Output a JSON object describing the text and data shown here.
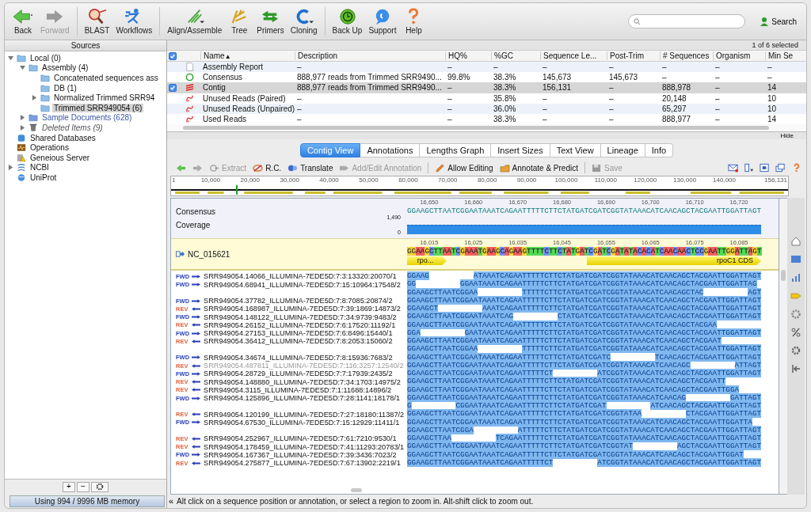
{
  "toolbar": [
    [
      {
        "label": "Back",
        "kind": "back",
        "disabled": false
      },
      {
        "label": "Forward",
        "kind": "forward",
        "disabled": true
      }
    ],
    [
      {
        "label": "BLAST",
        "kind": "blast",
        "disabled": false
      },
      {
        "label": "Workflows",
        "kind": "workflows",
        "disabled": false
      }
    ],
    [
      {
        "label": "Align/Assemble",
        "kind": "align",
        "disabled": false
      },
      {
        "label": "Tree",
        "kind": "tree",
        "disabled": false
      },
      {
        "label": "Primers",
        "kind": "primers",
        "disabled": false
      },
      {
        "label": "Cloning",
        "kind": "cloning",
        "disabled": false
      }
    ],
    [
      {
        "label": "Back Up",
        "kind": "backup",
        "disabled": false
      },
      {
        "label": "Support",
        "kind": "support",
        "disabled": false
      },
      {
        "label": "Help",
        "kind": "help",
        "disabled": false
      }
    ]
  ],
  "search_button": "Search",
  "sidebar": {
    "title": "Sources",
    "tree": [
      {
        "label": "Local (0)",
        "kind": "folder",
        "expandable": true,
        "expanded": true,
        "selected": false,
        "children": [
          {
            "label": "Assembly (4)",
            "kind": "folder",
            "expandable": true,
            "expanded": true,
            "selected": false,
            "children": [
              {
                "label": "Concatenated sequences ass",
                "kind": "folder",
                "expandable": false,
                "selected": false
              },
              {
                "label": "DB (1)",
                "kind": "folder",
                "expandable": false,
                "selected": false
              },
              {
                "label": "Normalized Trimmed SRR94",
                "kind": "folder",
                "expandable": true,
                "expanded": false,
                "selected": false
              },
              {
                "label": "Trimmed SRR949054 (6)",
                "kind": "folder",
                "expandable": false,
                "selected": true
              }
            ]
          },
          {
            "label": "Sample Documents (628)",
            "kind": "sample",
            "expandable": true,
            "expanded": false,
            "selected": false
          },
          {
            "label": "Deleted Items (9)",
            "kind": "trash",
            "expandable": true,
            "expanded": false,
            "selected": false
          }
        ]
      },
      {
        "label": "Shared Databases",
        "kind": "database",
        "expandable": false,
        "selected": false
      },
      {
        "label": "Operations",
        "kind": "operations",
        "expandable": false,
        "selected": false
      },
      {
        "label": "Geneious Server",
        "kind": "server",
        "expandable": false,
        "selected": false
      },
      {
        "label": "NCBI",
        "kind": "ncbi",
        "expandable": true,
        "expanded": false,
        "selected": false
      },
      {
        "label": "UniProt",
        "kind": "uniprot",
        "expandable": false,
        "selected": false
      }
    ],
    "buttons": [
      "+",
      "−"
    ],
    "memory": "Using 994 / 9996 MB memory",
    "collapse": "«"
  },
  "selection_count": "1 of 6 selected",
  "table": {
    "all_checked": true,
    "columns": [
      {
        "label": "Name",
        "sort_mark": "▲"
      },
      {
        "label": "Description"
      },
      {
        "label": "HQ%"
      },
      {
        "label": "%GC"
      },
      {
        "label": "Sequence Le..."
      },
      {
        "label": "Post-Trim"
      },
      {
        "label": "# Sequences"
      },
      {
        "label": "Organism"
      },
      {
        "label": "Min Se"
      }
    ],
    "rows": [
      {
        "kind": "report",
        "checked": false,
        "selected": false,
        "cells": [
          "Assembly Report",
          "–",
          "–",
          "–",
          "–",
          "–",
          "–",
          "–",
          "–"
        ]
      },
      {
        "kind": "consensus",
        "checked": false,
        "selected": false,
        "cells": [
          "Consensus",
          "888,977 reads from Trimmed SRR9490...",
          "99.8%",
          "38.3%",
          "145,673",
          "145,673",
          "–",
          "–",
          "–"
        ]
      },
      {
        "kind": "contig",
        "checked": true,
        "selected": true,
        "cells": [
          "Contig",
          "888,977 reads from Trimmed SRR9490...",
          "–",
          "38.3%",
          "156,131",
          "–",
          "888,978",
          "–",
          "14"
        ]
      },
      {
        "kind": "reads",
        "checked": false,
        "selected": false,
        "cells": [
          "Unused Reads (Paired)",
          "–",
          "–",
          "35.8%",
          "–",
          "–",
          "20,148",
          "–",
          "10"
        ]
      },
      {
        "kind": "reads",
        "checked": false,
        "selected": false,
        "cells": [
          "Unused Reads (Unpaired)",
          "–",
          "–",
          "36.0%",
          "–",
          "–",
          "65,297",
          "–",
          "10"
        ]
      },
      {
        "kind": "reads",
        "checked": false,
        "selected": false,
        "cells": [
          "Used Reads",
          "–",
          "–",
          "38.3%",
          "–",
          "–",
          "888,977",
          "–",
          "14"
        ]
      }
    ]
  },
  "hide": "Hide",
  "tabs": [
    {
      "label": "Contig View",
      "selected": true
    },
    {
      "label": "Annotations",
      "selected": false
    },
    {
      "label": "Lengths Graph",
      "selected": false
    },
    {
      "label": "Insert Sizes",
      "selected": false
    },
    {
      "label": "Text View",
      "selected": false
    },
    {
      "label": "Lineage",
      "selected": false
    },
    {
      "label": "Info",
      "selected": false
    }
  ],
  "viewer_tools": [
    {
      "kind": "back",
      "disabled": false
    },
    {
      "kind": "forward",
      "disabled": true
    },
    {
      "kind": "extract",
      "label": "Extract",
      "disabled": true
    },
    {
      "kind": "rc",
      "label": "R.C.",
      "disabled": false
    },
    {
      "kind": "translate",
      "label": "Translate",
      "disabled": false
    },
    {
      "kind": "annotation",
      "label": "Add/Edit Annotation",
      "disabled": true
    },
    {
      "kind": "edit",
      "label": "Allow Editing",
      "disabled": false
    },
    {
      "kind": "predict",
      "label": "Annotate & Predict",
      "disabled": false
    },
    {
      "kind": "save",
      "label": "Save",
      "disabled": true
    }
  ],
  "overview_ticks": [
    "1",
    "10,000",
    "20,000",
    "30,000",
    "40,000",
    "50,000",
    "60,000",
    "70,000",
    "80,000",
    "90,000",
    "100,000",
    "110,000",
    "120,000",
    "130,000",
    "140,000",
    "156,131"
  ],
  "consensus": {
    "label": "Consensus",
    "coverage_label": "Coverage",
    "coverage_max": "1,490",
    "coverage_min": "0",
    "ticks": [
      "16,650",
      "16,660",
      "16,670",
      "16,680",
      "16,690",
      "16,700",
      "16,710",
      "16,720"
    ],
    "sequence": "GGAAGCTTAATCGGAATAAATCAGAATTTTTCTTCTATGATCGATCGGTATAAACATCAACAGCTACGAATTGGATTAGT"
  },
  "reference": {
    "name": "NC_015621",
    "ticks": [
      "16,015",
      "16,025",
      "16,035",
      "16,045",
      "16,055",
      "16,065",
      "16,075",
      "16,085"
    ],
    "sequence": "GGAAGCTTAATCGAAATGAAGCAGAAGTTTTCTTCTATGATCGATCGATATACACATCAACAACTCCGAATTGGATTAGT",
    "annotations": [
      {
        "label": "rpo..."
      },
      {
        "label": "rpoC1 CDS"
      }
    ]
  },
  "reads": [
    {
      "dir_label": "FWD",
      "kind": "forward",
      "name": "SRR949054.14066_ILLUMINA-7EDE5D:7:3:13320:20070/1",
      "dimmed": false,
      "sequence": "GGAAG          ATAAATCAGAATTTTTCTTCTATGATCGATCGGTATAAACATCAACAGCTACGAATTGGATTAGT"
    },
    {
      "dir_label": "FWD",
      "kind": "forward",
      "name": "SRR949054.68941_ILLUMINA-7EDE5D:7:15:10964:17548/2",
      "dimmed": false,
      "sequence": "GG          GGAATAAATCAGAATTTTTCTTCTATGATCGATCGGTATAAACATCAACAGCTACGAATTGGATTAG"
    },
    {
      "sequence": "GGAAGCTTAATCGGAA          TTTTTCTTCTATGATCGATCGGTATAAACATCAACAGCTAC          AGT"
    },
    {
      "dir_label": "FWD",
      "kind": "forward",
      "name": "SRR949054.37782_ILLUMINA-7EDE5D:7:8:7085:20874/2",
      "dimmed": false,
      "sequence": "GGAAGCTTAATCGGAATAAATCAGAATTTTTCTTCTATGATCGATCGGTATAAACATCAACAGCTACGAATTGGATTAGT"
    },
    {
      "dir_label": "REV",
      "kind": "reverse",
      "name": "SRR949054.168987_ILLUMINA-7EDE5D:7:39:1869:14873/2",
      "dimmed": false,
      "sequence": "GGAAGCT          AAATCAGAATTTTTCTTCTATGATCGATCGGTATAAACATCAACAGCTACGAATTGGATTAGT"
    },
    {
      "dir_label": "FWD",
      "kind": "forward",
      "name": "SRR949054.148122_ILLUMINA-7EDE5D:7:34:9739:9483/2",
      "dimmed": false,
      "sequence": "GGAAGCTTAATCGGAATAAATCAG          CTATGATCGATCGGTATAAACATCAACAGCTACGAATTGGATTAGT"
    },
    {
      "dir_label": "REV",
      "kind": "reverse",
      "name": "SRR949054.26152_ILLUMINA-7EDE5D:7:6:17520:11192/1",
      "dimmed": false,
      "sequence": "GGAAGCTTAATCGGAATAAATCAGAATTTTTCTTCTATGATCGATCGGTATAAACATCAACAGCTACGAA"
    },
    {
      "dir_label": "FWD",
      "kind": "forward",
      "name": "SRR949054.27153_ILLUMINA-7EDE5D:7:6:8496:15440/1",
      "dimmed": false,
      "sequence": "GGA          GAATAAATCAGAATTTTTCTTCTATGATCGATCGGTATAAACATCAACAGCTACGAATTGGATTAGT"
    },
    {
      "dir_label": "REV",
      "kind": "reverse",
      "name": "SRR949054.36412_ILLUMINA-7EDE5D:7:8:2053:15060/2",
      "dimmed": false,
      "sequence": "GGAAGCTTAATCGGAATAAATCAGAATTTTTCTTCTATGATCGATCGGTATAAACATCAACAGCTACGAAT"
    },
    {
      "sequence": "GGAAGCTTAATCGGAA          TTTTTCTTCTATGATCGATCGGTATAAACATCAACAGCTACGAATTGGATTAGT"
    },
    {
      "dir_label": "FWD",
      "kind": "forward",
      "name": "SRR949054.34674_ILLUMINA-7EDE5D:7:8:15936:7683/2",
      "dimmed": false,
      "sequence": "GGAAGCTTAATCGGAATAAATCAGAATTTTTCTTCTATGATCGATC          TCAACAGCTACGAATTGGATTAGT"
    },
    {
      "dir_label": "REV",
      "kind": "reverse",
      "name": "SRR949054.487811_ILLUMINA-7EDE5D:7:116:3257:12540/2",
      "dimmed": true,
      "sequence": "GGAAGCTTAATCGGAATAAATCAGAATTTTTCTTCTATGATCGATCGGTATAAACATCAACAGC          ATTAGT"
    },
    {
      "dir_label": "FWD",
      "kind": "forward",
      "name": "SRR949054.28729_ILLUMINA-7EDE5D:7:7:17939:2435/2",
      "dimmed": false,
      "sequence": "GGAAGCTTAATCGGAATAAATCAGAATTTTTCT          ATCGGTATAAACATCAACAGCTACGAATTGGATTAGT"
    },
    {
      "dir_label": "REV",
      "kind": "reverse",
      "name": "SRR949054.148880_ILLUMINA-7EDE5D:7:34:1703:14975/2",
      "dimmed": false,
      "sequence": "GGAAGCTTAATCGGAATAAATCAGAATTTTTCTTCTATGATCGATCGGTATAAACATCAACAGCTACGAATT"
    },
    {
      "dir_label": "REV",
      "kind": "reverse",
      "name": "SRR949054.3115_ILLUMINA-7EDE5D:7:1:11688:14896/2",
      "dimmed": false,
      "sequence": "GGAAGCTTAATCGGAATAAATCAGAATTTTTCTTCTATGATCGATCGGTATAAACATCAACAGCTACGAATTGGA"
    },
    {
      "dir_label": "FWD",
      "kind": "forward",
      "name": "SRR949054.125896_ILLUMINA-7EDE5D:7:28:1141:18178/1",
      "dimmed": false,
      "sequence": "GGAAGCTTAATCGGAATAAATCAGAATTTTTCTTCTATGATCGATCGGTATAAACATCAACAG          GATTAGT"
    },
    {
      "sequence": "G          CGGAATAAATCAGAATTTTTCTTCTATGATCGAT          ATCAACAGCTACGAATTGGATTAGT"
    },
    {
      "dir_label": "REV",
      "kind": "reverse",
      "name": "SRR949054.120199_ILLUMINA-7EDE5D:7:27:18180:11387/2",
      "dimmed": false,
      "sequence": "GGAAGCTTAATCGGAATAAATCAGAATTTTTCTTCTATGATCGATCGGTATAA          CTACGAATTGGATTAGT"
    },
    {
      "dir_label": "FWD",
      "kind": "forward",
      "name": "SRR949054.67530_ILLUMINA-7EDE5D:7:15:12929:11411/1",
      "dimmed": false,
      "sequence": "GGAAGCTTAATCGGAATAAATCAGAATTTTTCTTCTATGATCGATCGGTATAAACATCAACAGCTACGAATTGGATTA"
    },
    {
      "sequence": "GGAAGCTTAATCGGA          ATTTTTCTTCTATGATCGATCGGTATAAACATCAACAGCTACGAATTGGATTAGT"
    },
    {
      "dir_label": "REV",
      "kind": "reverse",
      "name": "SRR949054.252967_ILLUMINA-7EDE5D:7:61:7210:9530/1",
      "dimmed": false,
      "sequence": "GGAAGCTTAA          TCAGAATTTTTCTTCTATGATCGATCGGTATAAACATCAACAGCTACGAATTGGATTAGT"
    },
    {
      "dir_label": "REV",
      "kind": "reverse",
      "name": "SRR949054.178459_ILLUMINA-7EDE5D:7:41:11293:20783/1",
      "dimmed": false,
      "sequence": "GGAAGCTTAATCGGAATAAATCAGAATTTTTCTTCTATGATCGATCGGTAT          AGCTACGAATTGGATTAGT"
    },
    {
      "dir_label": "FWD",
      "kind": "forward",
      "name": "SRR949054.167367_ILLUMINA-7EDE5D:7:39:3436:7023/2",
      "dimmed": false,
      "sequence": "GGAAGCTTAATCGGAATAAATCAGAATTTTTCTTCTATGATCGATCGGTATAAACATCAACAGCTACGAATTGGAT"
    },
    {
      "dir_label": "REV",
      "kind": "reverse",
      "name": "SRR949054.275877_ILLUMINA-7EDE5D:7:67:13902:2219/1",
      "dimmed": false,
      "sequence": "GGAAGCTTAATCGGAATAAATCAGAATTTTTCT          ATCGGTATAAACATCAACAGCTACGAATTGGATTAGT"
    }
  ],
  "status_text": "Alt click on a sequence position or annotation, or select a region to zoom in. Alt-shift click to zoom out."
}
